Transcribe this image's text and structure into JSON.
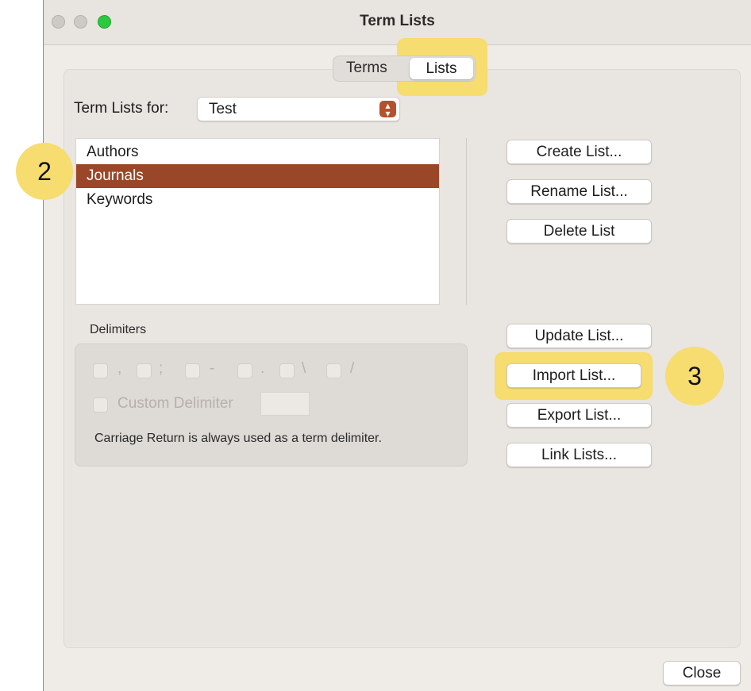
{
  "window": {
    "title": "Term Lists"
  },
  "tabs": [
    {
      "label": "Terms",
      "selected": false
    },
    {
      "label": "Lists",
      "selected": true
    }
  ],
  "term_lists_for": {
    "label": "Term Lists for:",
    "value": "Test"
  },
  "lists": [
    {
      "label": "Authors",
      "selected": false
    },
    {
      "label": "Journals",
      "selected": true
    },
    {
      "label": "Keywords",
      "selected": false
    }
  ],
  "buttons": {
    "create": "Create List...",
    "rename": "Rename List...",
    "delete": "Delete List",
    "update": "Update List...",
    "import": "Import List...",
    "export": "Export List...",
    "link": "Link Lists...",
    "close": "Close"
  },
  "delimiters": {
    "label": "Delimiters",
    "options": [
      ",",
      ";",
      "-",
      ".",
      "\\",
      "/"
    ],
    "custom_label": "Custom Delimiter",
    "note": "Carriage Return is always used as a term delimiter."
  },
  "annotations": {
    "step_2": "2",
    "step_3": "3"
  },
  "colors": {
    "selection": "#9a4729",
    "highlight": "#f7dc6f",
    "popup_accent": "#b5512c"
  }
}
